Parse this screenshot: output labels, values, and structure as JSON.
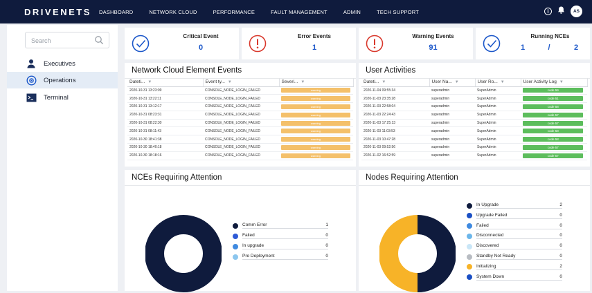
{
  "brand": {
    "logo_text": "DRIVENETS"
  },
  "nav": {
    "items": [
      "DASHBOARD",
      "NETWORK CLOUD",
      "PERFORMANCE",
      "FAULT MANAGEMENT",
      "ADMIN",
      "TECH SUPPORT"
    ]
  },
  "header": {
    "info_icon": "info-icon",
    "bell_icon": "bell-icon",
    "avatar_initials": "AS"
  },
  "sidebar": {
    "search_placeholder": "Search",
    "items": [
      {
        "label": "Executives",
        "icon": "user-icon"
      },
      {
        "label": "Operations",
        "icon": "gear-icon",
        "active": true
      },
      {
        "label": "Terminal",
        "icon": "terminal-icon"
      }
    ]
  },
  "kpis": {
    "critical": {
      "label": "Critical Event",
      "value": "0",
      "icon": "check-circle-icon",
      "color": "#1a56c9"
    },
    "error": {
      "label": "Error Events",
      "value": "1",
      "icon": "alert-circle-icon",
      "color": "#d9382c"
    },
    "warning": {
      "label": "Warning Events",
      "value": "91",
      "icon": "alert-circle-icon",
      "color": "#d9382c"
    },
    "running": {
      "label": "Running NCEs",
      "value_a": "1",
      "sep": "/",
      "value_b": "2",
      "icon": "check-circle-icon",
      "color": "#1a56c9"
    }
  },
  "nce_events": {
    "title": "Network Cloud Element Events",
    "columns": [
      "Dateti...",
      "Event ty...",
      "Severi..."
    ],
    "rows": [
      {
        "date": "2020-10-31 13:23:09",
        "event": "CONSOLE_NODE_LOGIN_FAILED",
        "severity": "warning"
      },
      {
        "date": "2020-10-31 13:22:11",
        "event": "CONSOLE_NODE_LOGIN_FAILED",
        "severity": "warning"
      },
      {
        "date": "2020-10-31 13:12:17",
        "event": "CONSOLE_NODE_LOGIN_FAILED",
        "severity": "warning"
      },
      {
        "date": "2020-10-31 08:23:31",
        "event": "CONSOLE_NODE_LOGIN_FAILED",
        "severity": "warning"
      },
      {
        "date": "2020-10-31 08:22:30",
        "event": "CONSOLE_NODE_LOGIN_FAILED",
        "severity": "warning"
      },
      {
        "date": "2020-10-31 08:11:43",
        "event": "CONSOLE_NODE_LOGIN_FAILED",
        "severity": "warning"
      },
      {
        "date": "2020-10-30 18:41:38",
        "event": "CONSOLE_NODE_LOGIN_FAILED",
        "severity": "warning"
      },
      {
        "date": "2020-10-30 18:40:18",
        "event": "CONSOLE_NODE_LOGIN_FAILED",
        "severity": "warning"
      },
      {
        "date": "2020-10-30 18:18:16",
        "event": "CONSOLE_NODE_LOGIN_FAILED",
        "severity": "warning"
      }
    ]
  },
  "user_activities": {
    "title": "User Activities",
    "columns": [
      "Dateti...",
      "User Na...",
      "User Ro...",
      "User Activity Log"
    ],
    "rows": [
      {
        "date": "2020-11-04 09:55:34",
        "user": "superadmin",
        "role": "SuperAdmin",
        "log": "code 59"
      },
      {
        "date": "2020-11-03 23:35:28",
        "user": "superadmin",
        "role": "SuperAdmin",
        "log": "code 51"
      },
      {
        "date": "2020-11-03 22:58:04",
        "user": "superadmin",
        "role": "SuperAdmin",
        "log": "code 58"
      },
      {
        "date": "2020-11-03 22:24:43",
        "user": "superadmin",
        "role": "SuperAdmin",
        "log": "code 57"
      },
      {
        "date": "2020-11-03 17:25:13",
        "user": "superadmin",
        "role": "SuperAdmin",
        "log": "code 57"
      },
      {
        "date": "2020-11-03 11:03:53",
        "user": "superadmin",
        "role": "SuperAdmin",
        "log": "code 58"
      },
      {
        "date": "2020-11-03 10:47:28",
        "user": "superadmin",
        "role": "SuperAdmin",
        "log": "code 58"
      },
      {
        "date": "2020-11-03 09:52:56",
        "user": "superadmin",
        "role": "SuperAdmin",
        "log": "code 57"
      },
      {
        "date": "2020-11-02 16:52:59",
        "user": "superadmin",
        "role": "SuperAdmin",
        "log": "code 57"
      }
    ]
  },
  "nces_attention": {
    "title": "NCEs Requiring Attention",
    "legend": [
      {
        "label": "Comm Error",
        "value": "1",
        "color": "#0f1b3d"
      },
      {
        "label": "Failed",
        "value": "0",
        "color": "#2e5ad6"
      },
      {
        "label": "In upgrade",
        "value": "0",
        "color": "#3f8ae0"
      },
      {
        "label": "Pre Deployment",
        "value": "0",
        "color": "#8cc6ee"
      }
    ]
  },
  "nodes_attention": {
    "title": "Nodes Requiring Attention",
    "legend": [
      {
        "label": "In Upgrade",
        "value": "2",
        "color": "#0f1b3d"
      },
      {
        "label": "Upgrade Failed",
        "value": "0",
        "color": "#1a4fc4"
      },
      {
        "label": "Failed",
        "value": "0",
        "color": "#3f8ae0"
      },
      {
        "label": "Disconnected",
        "value": "0",
        "color": "#6cb6ea"
      },
      {
        "label": "Discovered",
        "value": "0",
        "color": "#c9e6f7"
      },
      {
        "label": "Standby Not Ready",
        "value": "0",
        "color": "#b8bcc2"
      },
      {
        "label": "Initializing",
        "value": "2",
        "color": "#f7b328"
      },
      {
        "label": "System Down",
        "value": "0",
        "color": "#1a4fc4"
      }
    ]
  }
}
